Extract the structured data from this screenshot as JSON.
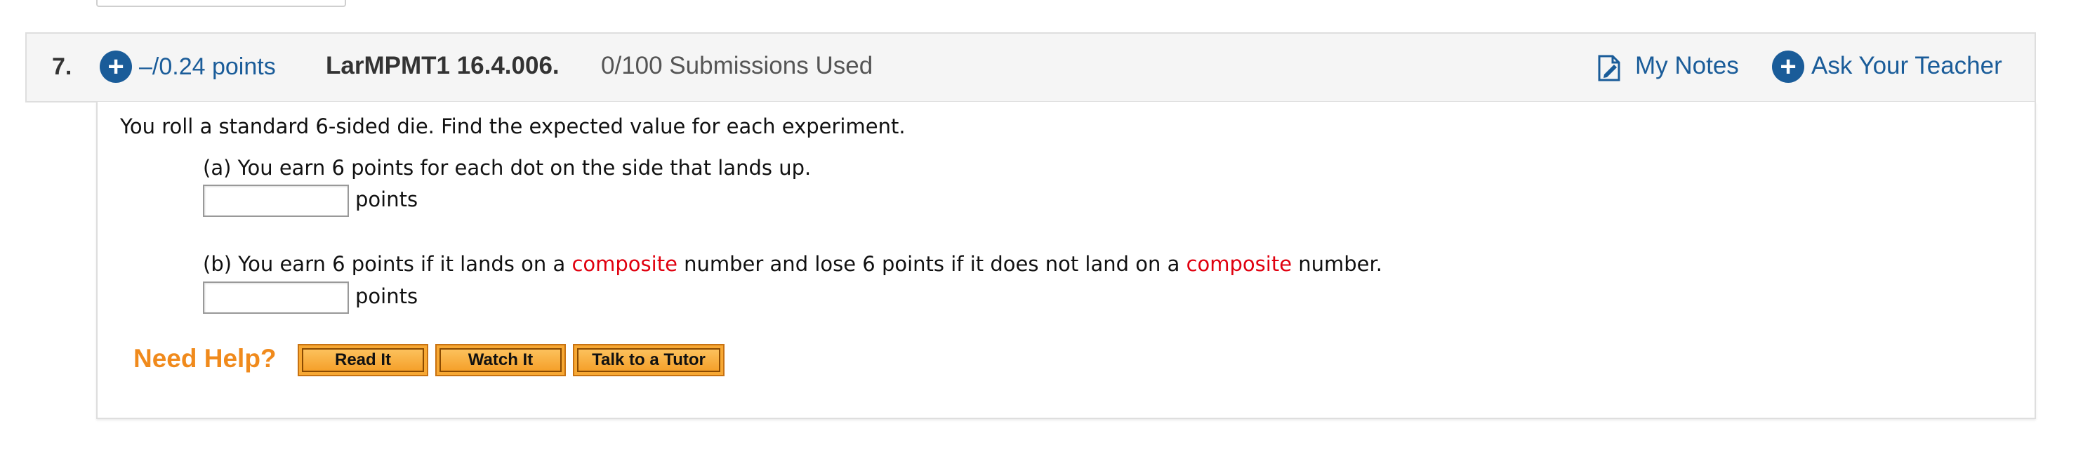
{
  "question": {
    "number": "7.",
    "points": "–/0.24 points",
    "code": "LarMPMT1 16.4.006.",
    "submissions": "0/100 Submissions Used",
    "my_notes": "My Notes",
    "ask_teacher": "Ask Your Teacher"
  },
  "body": {
    "intro": "You roll a standard 6-sided die. Find the expected value for each experiment.",
    "part_a": {
      "text": "(a) You earn 6 points for each dot on the side that lands up.",
      "unit": "points",
      "value": ""
    },
    "part_b": {
      "text_1": "(b) You earn 6 points if it lands on a ",
      "highlight_1": "composite",
      "text_2": " number and lose 6 points if it does not land on a ",
      "highlight_2": "composite",
      "text_3": " number.",
      "unit": "points",
      "value": ""
    }
  },
  "help": {
    "label": "Need Help?",
    "read_it": "Read It",
    "watch_it": "Watch It",
    "tutor": "Talk to a Tutor"
  },
  "colors": {
    "link": "#1a5c99",
    "highlight": "#e0000f",
    "help": "#f08a1c",
    "button": "#f7a834"
  }
}
